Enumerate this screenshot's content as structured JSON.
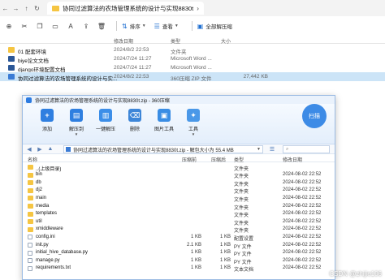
{
  "explorer": {
    "tab_title": "协同过滤算法的农场管理系统的设计与实现8830t",
    "toolbar": {
      "sort_label": "排序",
      "view_label": "查看",
      "extract_all_label": "全部解压缩"
    },
    "columns": {
      "date": "修改日期",
      "type": "类型",
      "size": "大小"
    },
    "rows": [
      {
        "name": "01 配套环境",
        "date": "2024/8/2 22:53",
        "type": "文件夹",
        "size": "",
        "icon": "folder"
      },
      {
        "name": "biye论文文档",
        "date": "2024/7/24 11:27",
        "type": "Microsoft Word ...",
        "size": "",
        "icon": "word"
      },
      {
        "name": "django环境配置文档",
        "date": "2024/7/24 11:27",
        "type": "Microsoft Word ...",
        "size": "",
        "icon": "word"
      },
      {
        "name": "协同过滤算法的农场管理系统的设计与实...",
        "date": "2024/8/2 22:53",
        "type": "360压缩 ZIP 文件",
        "size": "27,442 KB",
        "icon": "zip",
        "selected": true
      }
    ]
  },
  "zip": {
    "title": "协同过滤算法的农场管理系统的设计与实现8830t.zip - 360压缩",
    "toolbar": [
      {
        "label": "添加",
        "icon": "add-icon",
        "color": "#2f7fe0",
        "glyph": "+"
      },
      {
        "label": "解压到",
        "icon": "extract-icon",
        "color": "#2f7fe0",
        "glyph": "▤",
        "caret": true
      },
      {
        "label": "一键解压",
        "icon": "one-click-extract-icon",
        "color": "#3c8ee8",
        "glyph": "▥"
      },
      {
        "label": "删除",
        "icon": "delete-icon",
        "color": "#3d86d8",
        "glyph": "⌫"
      },
      {
        "label": "图片工具",
        "icon": "image-tool-icon",
        "color": "#3a8de4",
        "glyph": "▣"
      },
      {
        "label": "工具",
        "icon": "tool-icon",
        "color": "#4a98e8",
        "glyph": "✦",
        "caret": true
      }
    ],
    "scan_label": "扫描",
    "path": "协同过滤算法的农场管理系统的设计与实现8830t.zip - 解包大小为 55.4 MB",
    "columns": {
      "name": "名称",
      "compressed": "压缩前",
      "original": "压缩后",
      "type": "类型",
      "modified": "修改日期"
    },
    "rows": [
      {
        "name": "..(上级目录)",
        "cs": "",
        "os": "",
        "type": "文件夹",
        "md": "",
        "icon": "folder"
      },
      {
        "name": "bin",
        "cs": "",
        "os": "",
        "type": "文件夹",
        "md": "2024-08-02 22:52",
        "icon": "folder"
      },
      {
        "name": "db",
        "cs": "",
        "os": "",
        "type": "文件夹",
        "md": "2024-08-02 22:52",
        "icon": "folder"
      },
      {
        "name": "dj2",
        "cs": "",
        "os": "",
        "type": "文件夹",
        "md": "2024-08-02 22:52",
        "icon": "folder"
      },
      {
        "name": "main",
        "cs": "",
        "os": "",
        "type": "文件夹",
        "md": "2024-08-02 22:52",
        "icon": "folder"
      },
      {
        "name": "media",
        "cs": "",
        "os": "",
        "type": "文件夹",
        "md": "2024-08-02 22:52",
        "icon": "folder"
      },
      {
        "name": "templates",
        "cs": "",
        "os": "",
        "type": "文件夹",
        "md": "2024-08-02 22:52",
        "icon": "folder"
      },
      {
        "name": "util",
        "cs": "",
        "os": "",
        "type": "文件夹",
        "md": "2024-08-02 22:52",
        "icon": "folder"
      },
      {
        "name": "xmiddleware",
        "cs": "",
        "os": "",
        "type": "文件夹",
        "md": "2024-08-02 22:52",
        "icon": "folder"
      },
      {
        "name": "config.ini",
        "cs": "1 KB",
        "os": "1 KB",
        "type": "配置设置",
        "md": "2024-08-02 22:52",
        "icon": "file"
      },
      {
        "name": "init.py",
        "cs": "2.1 KB",
        "os": "1 KB",
        "type": "PY 文件",
        "md": "2024-08-02 22:52",
        "icon": "file"
      },
      {
        "name": "initial_hive_database.py",
        "cs": "1 KB",
        "os": "1 KB",
        "type": "PY 文件",
        "md": "2024-08-02 22:52",
        "icon": "file"
      },
      {
        "name": "manage.py",
        "cs": "1 KB",
        "os": "1 KB",
        "type": "PY 文件",
        "md": "2024-08-02 22:52",
        "icon": "file"
      },
      {
        "name": "requirements.txt",
        "cs": "1 KB",
        "os": "1 KB",
        "type": "文本文档",
        "md": "2024-08-02 22:52",
        "icon": "file"
      }
    ]
  },
  "watermark": "CSDN @zhijie106",
  "colors": {
    "folder": "#f5c542",
    "accent": "#2d7be0",
    "selection": "#cce4f7"
  }
}
